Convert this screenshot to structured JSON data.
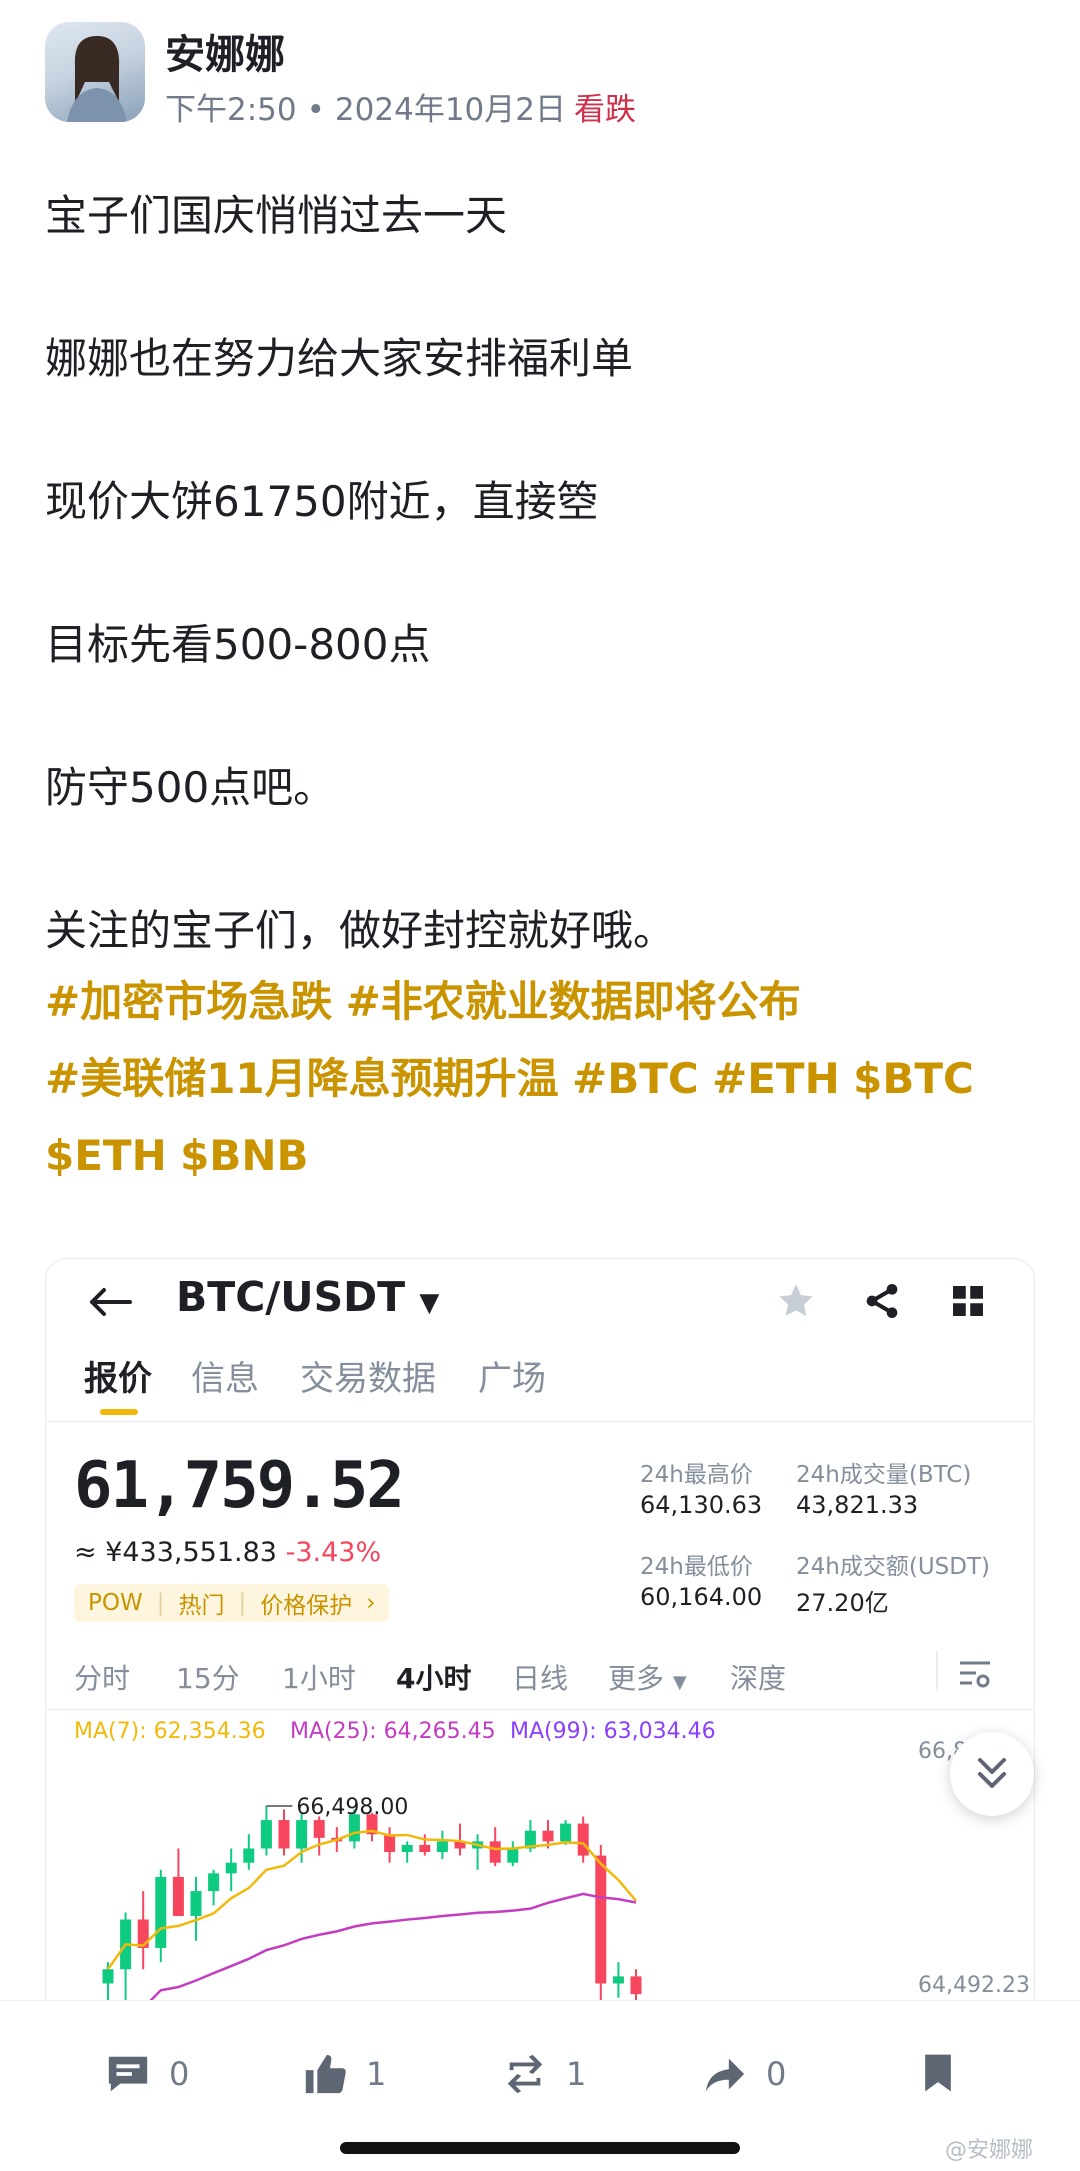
{
  "author": {
    "name": "安娜娜",
    "time": "下午2:50",
    "date": "2024年10月2日",
    "sentiment": "看跌"
  },
  "post": {
    "lines": [
      "宝子们国庆悄悄过去一天",
      "娜娜也在努力给大家安排福利单",
      "现价大饼61750附近，直接箜",
      "目标先看500-800点",
      "防守500点吧。",
      "关注的宝子们，做好封控就好哦。"
    ],
    "tags": [
      "#加密市场急跌",
      "#非农就业数据即将公布",
      "#美联储11月降息预期升温",
      "#BTC",
      "#ETH",
      "$BTC",
      "$ETH",
      "$BNB"
    ]
  },
  "card": {
    "pair": "BTC/USDT",
    "tabs": [
      "报价",
      "信息",
      "交易数据",
      "广场"
    ],
    "price": "61,759.52",
    "cny": "≈ ¥433,551.83",
    "change": "-3.43%",
    "badges": [
      "POW",
      "热门",
      "价格保护"
    ],
    "stats": {
      "high_label": "24h最高价",
      "high": "64,130.63",
      "low_label": "24h最低价",
      "low": "60,164.00",
      "vol_btc_label": "24h成交量(BTC)",
      "vol_btc": "43,821.33",
      "vol_usdt_label": "24h成交额(USDT)",
      "vol_usdt": "27.20亿"
    },
    "intervals": [
      "分时",
      "15分",
      "1小时",
      "4小时",
      "日线",
      "更多",
      "深度"
    ],
    "selected_interval": "4小时",
    "ma": {
      "ma7": "MA(7): 62,354.36",
      "ma25": "MA(25): 64,265.45",
      "ma99": "MA(99): 63,034.46"
    },
    "chart_data": {
      "type": "candlestick",
      "high_marker": "66,498.00",
      "price_labels": [
        "66,8",
        "64,492.23"
      ],
      "ylim": [
        63500,
        67300
      ],
      "candles": [
        {
          "o": 64000,
          "h": 64300,
          "l": 63600,
          "c": 64200
        },
        {
          "o": 64200,
          "h": 65000,
          "l": 63700,
          "c": 64900
        },
        {
          "o": 64900,
          "h": 65300,
          "l": 64200,
          "c": 64500
        },
        {
          "o": 64500,
          "h": 65600,
          "l": 64300,
          "c": 65500
        },
        {
          "o": 65500,
          "h": 65900,
          "l": 65200,
          "c": 64950
        },
        {
          "o": 64950,
          "h": 65500,
          "l": 64600,
          "c": 65300
        },
        {
          "o": 65300,
          "h": 65600,
          "l": 65100,
          "c": 65550
        },
        {
          "o": 65550,
          "h": 65900,
          "l": 65300,
          "c": 65700
        },
        {
          "o": 65700,
          "h": 66100,
          "l": 65600,
          "c": 65900
        },
        {
          "o": 65900,
          "h": 66498,
          "l": 65800,
          "c": 66300
        },
        {
          "o": 66300,
          "h": 66450,
          "l": 65800,
          "c": 65900
        },
        {
          "o": 65900,
          "h": 66400,
          "l": 65700,
          "c": 66300
        },
        {
          "o": 66300,
          "h": 66350,
          "l": 65800,
          "c": 66050
        },
        {
          "o": 66050,
          "h": 66200,
          "l": 65850,
          "c": 66000
        },
        {
          "o": 66000,
          "h": 66450,
          "l": 65900,
          "c": 66380
        },
        {
          "o": 66380,
          "h": 66400,
          "l": 66000,
          "c": 66100
        },
        {
          "o": 66100,
          "h": 66200,
          "l": 65700,
          "c": 65850
        },
        {
          "o": 65850,
          "h": 66000,
          "l": 65700,
          "c": 65950
        },
        {
          "o": 65950,
          "h": 66100,
          "l": 65800,
          "c": 65850
        },
        {
          "o": 65850,
          "h": 66150,
          "l": 65750,
          "c": 66000
        },
        {
          "o": 66000,
          "h": 66250,
          "l": 65800,
          "c": 65900
        },
        {
          "o": 65900,
          "h": 66100,
          "l": 65600,
          "c": 66000
        },
        {
          "o": 66000,
          "h": 66200,
          "l": 65650,
          "c": 65700
        },
        {
          "o": 65700,
          "h": 66000,
          "l": 65650,
          "c": 65900
        },
        {
          "o": 65900,
          "h": 66300,
          "l": 65850,
          "c": 66150
        },
        {
          "o": 66150,
          "h": 66300,
          "l": 65900,
          "c": 66000
        },
        {
          "o": 66000,
          "h": 66300,
          "l": 65950,
          "c": 66250
        },
        {
          "o": 66250,
          "h": 66350,
          "l": 65700,
          "c": 65800
        },
        {
          "o": 65800,
          "h": 65950,
          "l": 63700,
          "c": 64000
        },
        {
          "o": 64000,
          "h": 64300,
          "l": 63800,
          "c": 64100
        },
        {
          "o": 64100,
          "h": 64200,
          "l": 63700,
          "c": 63850
        }
      ]
    }
  },
  "actions": {
    "comments": "0",
    "likes": "1",
    "reposts": "1",
    "shares": "0"
  },
  "watermark": "@安娜娜",
  "colors": {
    "accent": "#c99400",
    "up": "#0ecb81",
    "down": "#f6465d",
    "ma7": "#f0b90b",
    "ma25": "#c43cc1",
    "ma99": "#8a3ffc"
  }
}
